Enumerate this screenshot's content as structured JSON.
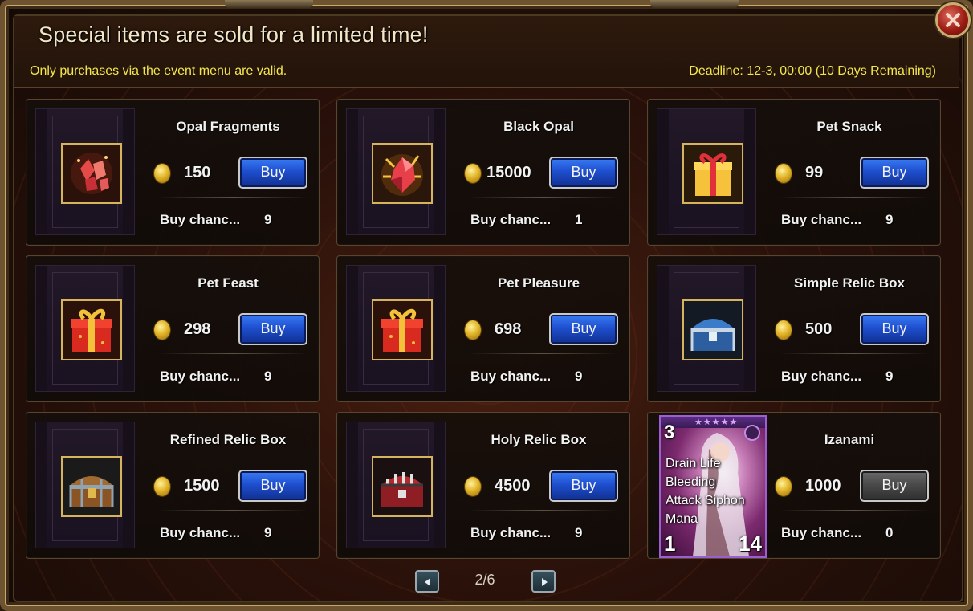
{
  "dialog": {
    "title": "Special items are sold for a limited time!",
    "notice": "Only purchases via the event menu are valid.",
    "deadline": "Deadline: 12-3, 00:00 (10 Days Remaining)"
  },
  "items": [
    {
      "name": "Opal Fragments",
      "price": "150",
      "buy_label": "Buy",
      "chance_label": "Buy chanc...",
      "chance_value": "9",
      "icon": "opal-fragments-icon"
    },
    {
      "name": "Black Opal",
      "price": "15000",
      "buy_label": "Buy",
      "chance_label": "Buy chanc...",
      "chance_value": "1",
      "icon": "black-opal-icon"
    },
    {
      "name": "Pet Snack",
      "price": "99",
      "buy_label": "Buy",
      "chance_label": "Buy chanc...",
      "chance_value": "9",
      "icon": "gift-box-icon"
    },
    {
      "name": "Pet Feast",
      "price": "298",
      "buy_label": "Buy",
      "chance_label": "Buy chanc...",
      "chance_value": "9",
      "icon": "red-gift-box-icon"
    },
    {
      "name": "Pet Pleasure",
      "price": "698",
      "buy_label": "Buy",
      "chance_label": "Buy chanc...",
      "chance_value": "9",
      "icon": "red-gift-box-icon"
    },
    {
      "name": "Simple Relic Box",
      "price": "500",
      "buy_label": "Buy",
      "chance_label": "Buy chanc...",
      "chance_value": "9",
      "icon": "blue-chest-icon"
    },
    {
      "name": "Refined Relic Box",
      "price": "1500",
      "buy_label": "Buy",
      "chance_label": "Buy chanc...",
      "chance_value": "9",
      "icon": "wooden-chest-icon"
    },
    {
      "name": "Holy Relic Box",
      "price": "4500",
      "buy_label": "Buy",
      "chance_label": "Buy chanc...",
      "chance_value": "9",
      "icon": "red-chest-icon"
    },
    {
      "name": "Izanami",
      "price": "1000",
      "buy_label": "Buy",
      "chance_label": "Buy chanc...",
      "chance_value": "0",
      "icon": "hero-card-icon"
    }
  ],
  "hero_card": {
    "cost": "3",
    "skills": [
      "Drain Life",
      "Bleeding",
      "Attack Siphon",
      "Mana"
    ],
    "attack": "1",
    "health": "14",
    "stars": "★★★★★"
  },
  "pagination": {
    "current": "2/6"
  },
  "colors": {
    "accent_yellow": "#f3e74a",
    "buy_blue": "#1e4fcf",
    "buy_disabled": "#4a4a4a",
    "frame_gold": "#c8a866"
  }
}
